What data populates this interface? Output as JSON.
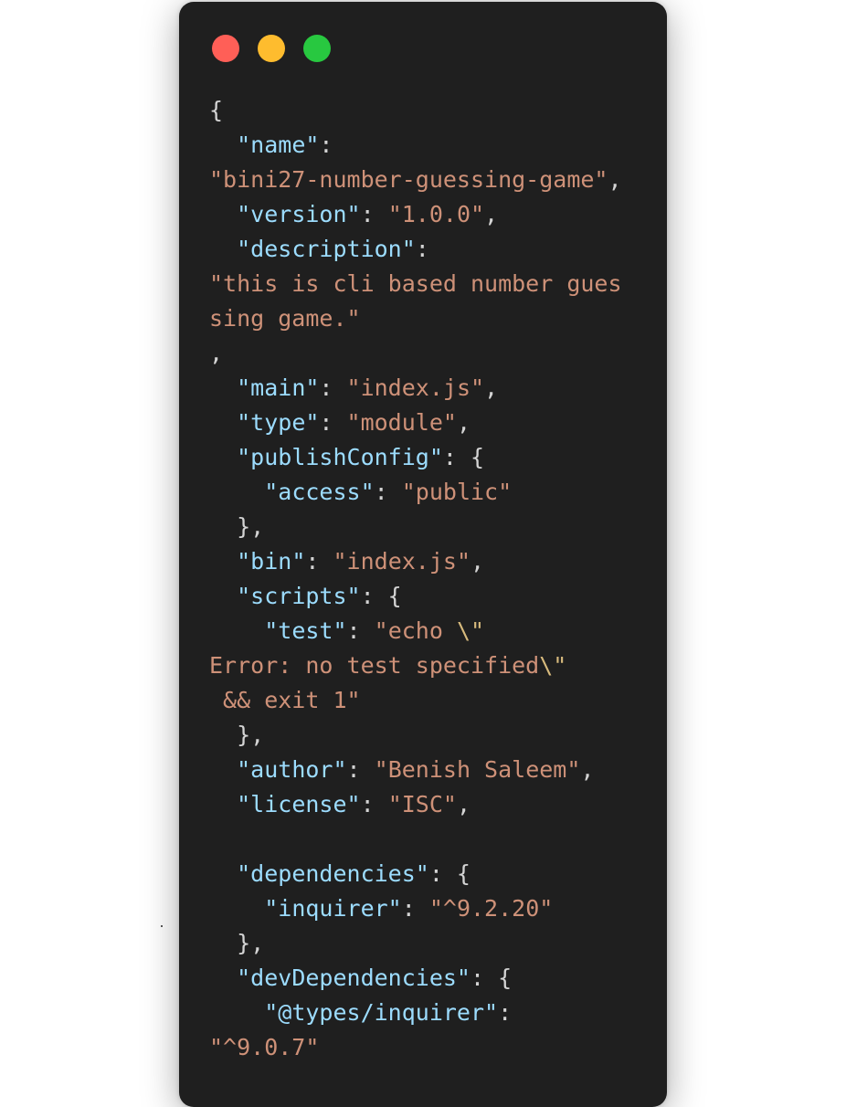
{
  "window": {
    "bg": "#1f1f1f",
    "controls": [
      {
        "name": "close-dot",
        "color": "#ff5f57"
      },
      {
        "name": "minimize-dot",
        "color": "#febc2e"
      },
      {
        "name": "maximize-dot",
        "color": "#28c840"
      }
    ]
  },
  "colors": {
    "key": "#9cdcfe",
    "string": "#ce9178",
    "escape": "#d7ba7d",
    "punct": "#d4d4d4"
  },
  "code": {
    "lines": [
      [
        {
          "t": "p",
          "v": "{"
        }
      ],
      [
        {
          "t": "p",
          "v": "  "
        },
        {
          "t": "k",
          "v": "\"name\""
        },
        {
          "t": "p",
          "v": ":"
        }
      ],
      [
        {
          "t": "s",
          "v": "\"bini27-number-guessing-game\""
        },
        {
          "t": "p",
          "v": ","
        }
      ],
      [
        {
          "t": "p",
          "v": "  "
        },
        {
          "t": "k",
          "v": "\"version\""
        },
        {
          "t": "p",
          "v": ": "
        },
        {
          "t": "s",
          "v": "\"1.0.0\""
        },
        {
          "t": "p",
          "v": ","
        }
      ],
      [
        {
          "t": "p",
          "v": "  "
        },
        {
          "t": "k",
          "v": "\"description\""
        },
        {
          "t": "p",
          "v": ":"
        }
      ],
      [
        {
          "t": "s",
          "v": "\"this is cli based number gues"
        }
      ],
      [
        {
          "t": "s",
          "v": "sing game.\""
        }
      ],
      [
        {
          "t": "p",
          "v": ","
        }
      ],
      [
        {
          "t": "p",
          "v": "  "
        },
        {
          "t": "k",
          "v": "\"main\""
        },
        {
          "t": "p",
          "v": ": "
        },
        {
          "t": "s",
          "v": "\"index.js\""
        },
        {
          "t": "p",
          "v": ","
        }
      ],
      [
        {
          "t": "p",
          "v": "  "
        },
        {
          "t": "k",
          "v": "\"type\""
        },
        {
          "t": "p",
          "v": ": "
        },
        {
          "t": "s",
          "v": "\"module\""
        },
        {
          "t": "p",
          "v": ","
        }
      ],
      [
        {
          "t": "p",
          "v": "  "
        },
        {
          "t": "k",
          "v": "\"publishConfig\""
        },
        {
          "t": "p",
          "v": ": {"
        }
      ],
      [
        {
          "t": "p",
          "v": "    "
        },
        {
          "t": "k",
          "v": "\"access\""
        },
        {
          "t": "p",
          "v": ": "
        },
        {
          "t": "s",
          "v": "\"public\""
        }
      ],
      [
        {
          "t": "p",
          "v": "  },"
        }
      ],
      [
        {
          "t": "p",
          "v": "  "
        },
        {
          "t": "k",
          "v": "\"bin\""
        },
        {
          "t": "p",
          "v": ": "
        },
        {
          "t": "s",
          "v": "\"index.js\""
        },
        {
          "t": "p",
          "v": ","
        }
      ],
      [
        {
          "t": "p",
          "v": "  "
        },
        {
          "t": "k",
          "v": "\"scripts\""
        },
        {
          "t": "p",
          "v": ": {"
        }
      ],
      [
        {
          "t": "p",
          "v": "    "
        },
        {
          "t": "k",
          "v": "\"test\""
        },
        {
          "t": "p",
          "v": ": "
        },
        {
          "t": "s",
          "v": "\"echo "
        },
        {
          "t": "e",
          "v": "\\\""
        }
      ],
      [
        {
          "t": "s",
          "v": "Error: no test specified"
        },
        {
          "t": "e",
          "v": "\\\""
        }
      ],
      [
        {
          "t": "s",
          "v": " && exit 1\""
        }
      ],
      [
        {
          "t": "p",
          "v": "  },"
        }
      ],
      [
        {
          "t": "p",
          "v": "  "
        },
        {
          "t": "k",
          "v": "\"author\""
        },
        {
          "t": "p",
          "v": ": "
        },
        {
          "t": "s",
          "v": "\"Benish Saleem\""
        },
        {
          "t": "p",
          "v": ","
        }
      ],
      [
        {
          "t": "p",
          "v": "  "
        },
        {
          "t": "k",
          "v": "\"license\""
        },
        {
          "t": "p",
          "v": ": "
        },
        {
          "t": "s",
          "v": "\"ISC\""
        },
        {
          "t": "p",
          "v": ","
        }
      ],
      [
        {
          "t": "p",
          "v": ""
        }
      ],
      [
        {
          "t": "p",
          "v": "  "
        },
        {
          "t": "k",
          "v": "\"dependencies\""
        },
        {
          "t": "p",
          "v": ": {"
        }
      ],
      [
        {
          "t": "p",
          "v": "    "
        },
        {
          "t": "k",
          "v": "\"inquirer\""
        },
        {
          "t": "p",
          "v": ": "
        },
        {
          "t": "s",
          "v": "\"^9.2.20\""
        }
      ],
      [
        {
          "t": "p",
          "v": "  },"
        }
      ],
      [
        {
          "t": "p",
          "v": "  "
        },
        {
          "t": "k",
          "v": "\"devDependencies\""
        },
        {
          "t": "p",
          "v": ": {"
        }
      ],
      [
        {
          "t": "p",
          "v": "    "
        },
        {
          "t": "k",
          "v": "\"@types/inquirer\""
        },
        {
          "t": "p",
          "v": ":"
        }
      ],
      [
        {
          "t": "s",
          "v": "\"^9.0.7\""
        }
      ]
    ]
  }
}
